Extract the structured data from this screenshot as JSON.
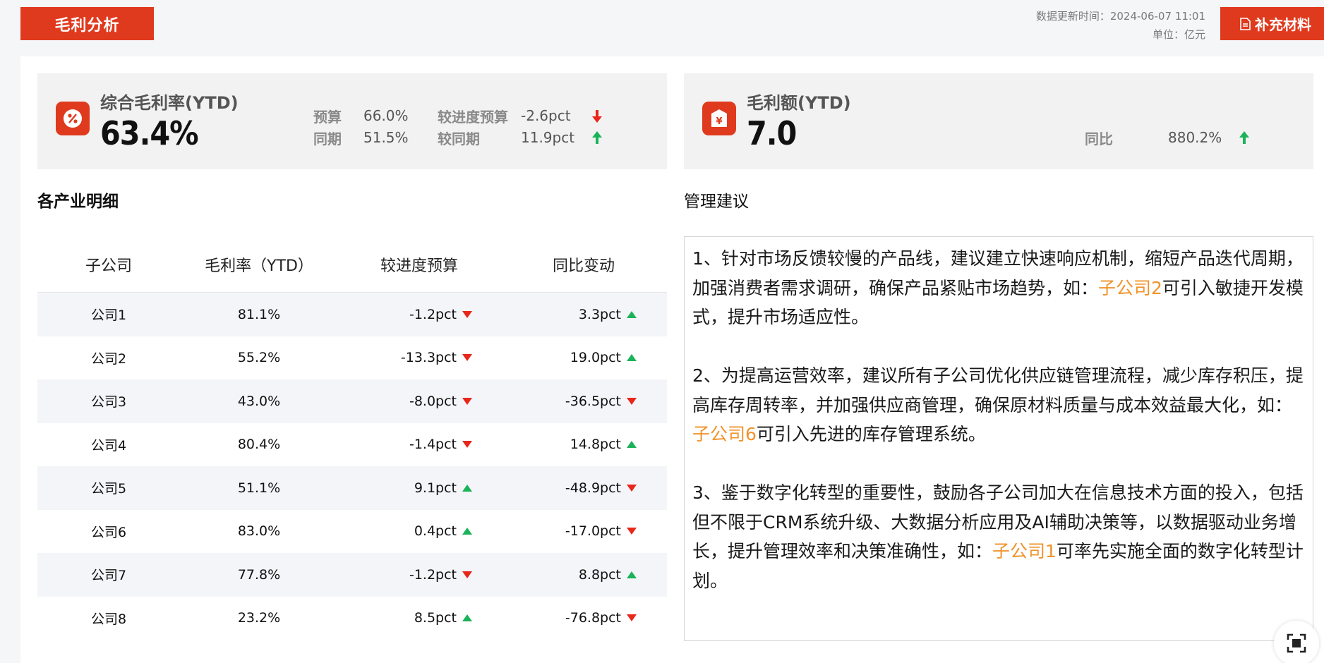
{
  "header": {
    "title": "毛利分析",
    "update_time": "数据更新时间：2024-06-07 11:01",
    "unit": "单位：亿元",
    "supplement_button": "补充材料"
  },
  "kpi_margin_rate": {
    "title": "综合毛利率(YTD)",
    "value": "63.4%",
    "budget_label": "预算",
    "budget_value": "66.0%",
    "prior_label": "同期",
    "prior_value": "51.5%",
    "vs_budget_label": "较进度预算",
    "vs_budget_value": "-2.6pct",
    "vs_prior_label": "较同期",
    "vs_prior_value": "11.9pct",
    "vs_budget_trend": "down",
    "vs_prior_trend": "up"
  },
  "kpi_margin_amount": {
    "title": "毛利额(YTD)",
    "value": "7.0",
    "yoy_label": "同比",
    "yoy_value": "880.2%",
    "yoy_trend": "up"
  },
  "detail": {
    "section_title": "各产业明细",
    "columns": [
      "子公司",
      "毛利率（YTD）",
      "较进度预算",
      "同比变动"
    ],
    "rows": [
      {
        "company": "公司1",
        "margin": "81.1%",
        "vs_budget": "-1.2pct",
        "vs_budget_trend": "down",
        "yoy": "3.3pct",
        "yoy_trend": "up"
      },
      {
        "company": "公司2",
        "margin": "55.2%",
        "vs_budget": "-13.3pct",
        "vs_budget_trend": "down",
        "yoy": "19.0pct",
        "yoy_trend": "up"
      },
      {
        "company": "公司3",
        "margin": "43.0%",
        "vs_budget": "-8.0pct",
        "vs_budget_trend": "down",
        "yoy": "-36.5pct",
        "yoy_trend": "down"
      },
      {
        "company": "公司4",
        "margin": "80.4%",
        "vs_budget": "-1.4pct",
        "vs_budget_trend": "down",
        "yoy": "14.8pct",
        "yoy_trend": "up"
      },
      {
        "company": "公司5",
        "margin": "51.1%",
        "vs_budget": "9.1pct",
        "vs_budget_trend": "up",
        "yoy": "-48.9pct",
        "yoy_trend": "down"
      },
      {
        "company": "公司6",
        "margin": "83.0%",
        "vs_budget": "0.4pct",
        "vs_budget_trend": "up",
        "yoy": "-17.0pct",
        "yoy_trend": "down"
      },
      {
        "company": "公司7",
        "margin": "77.8%",
        "vs_budget": "-1.2pct",
        "vs_budget_trend": "down",
        "yoy": "8.8pct",
        "yoy_trend": "up"
      },
      {
        "company": "公司8",
        "margin": "23.2%",
        "vs_budget": "8.5pct",
        "vs_budget_trend": "up",
        "yoy": "-76.8pct",
        "yoy_trend": "down"
      }
    ]
  },
  "advice": {
    "title": "管理建议",
    "items": [
      {
        "before": "1、针对市场反馈较慢的产品线，建议建立快速响应机制，缩短产品迭代周期，加强消费者需求调研，确保产品紧贴市场趋势，如：",
        "highlight": "子公司2",
        "after": "可引入敏捷开发模式，提升市场适应性。"
      },
      {
        "before": "2、为提高运营效率，建议所有子公司优化供应链管理流程，减少库存积压，提高库存周转率，并加强供应商管理，确保原材料质量与成本效益最大化，如：",
        "highlight": "子公司6",
        "after": "可引入先进的库存管理系统。"
      },
      {
        "before": "3、鉴于数字化转型的重要性，鼓励各子公司加大在信息技术方面的投入，包括但不限于CRM系统升级、大数据分析应用及AI辅助决策等，以数据驱动业务增长，提升管理效率和决策准确性，如：",
        "highlight": "子公司1",
        "after": "可率先实施全面的数字化转型计划。"
      }
    ]
  },
  "colors": {
    "brand_red": "#e03a1e",
    "up_green": "#1ab358",
    "down_red": "#e8261a",
    "highlight_orange": "#f0932b"
  }
}
